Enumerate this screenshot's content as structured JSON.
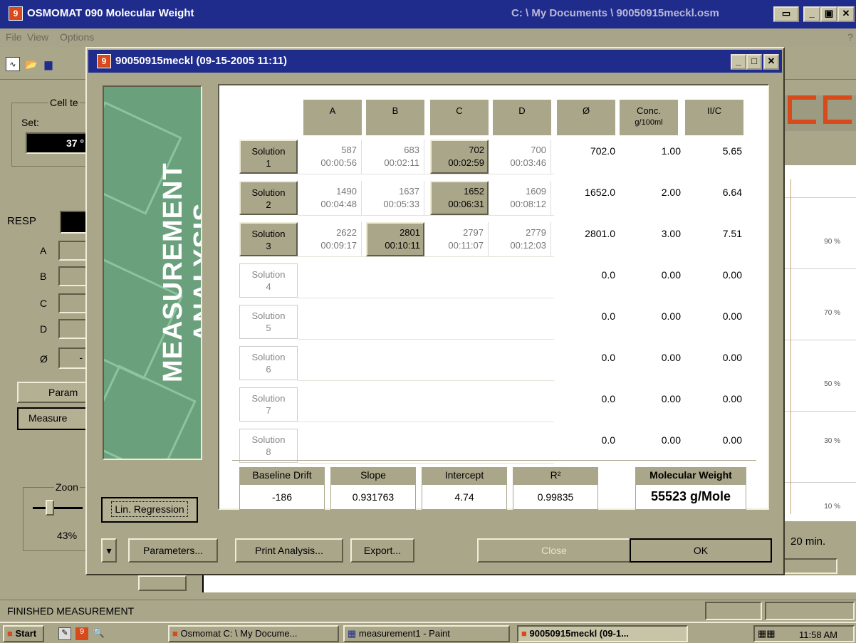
{
  "app": {
    "title": "OSMOMAT 090 Molecular Weight",
    "path": "C: \\ My Documents \\ 90050915meckl.osm",
    "menu": [
      "File",
      "View",
      "Options"
    ],
    "help": "?"
  },
  "left_panel": {
    "cell_temp_label": "Cell te",
    "set_label": "Set:",
    "set_value": "37 °",
    "resp_label": "RESP",
    "rows": [
      "A",
      "B",
      "C",
      "D",
      "Ø"
    ],
    "phi_value": "-",
    "param_button": "Param",
    "measure_button": "Measure",
    "zoom_label": "Zoon",
    "zoom_value": "43%",
    "zoom_level_percent": 43
  },
  "graph": {
    "percent_labels": [
      "90 %",
      "70 %",
      "50 %",
      "30 %",
      "10 %"
    ],
    "time_label": "20 min."
  },
  "status_bar": "FINISHED MEASUREMENT",
  "dialog": {
    "title": "90050915meckl (09-15-2005 11:11)",
    "sidebar_text": "MEASUREMENT ANALYSIS",
    "columns": [
      "A",
      "B",
      "C",
      "D",
      "Ø",
      "Conc.",
      "ΙΙ/C"
    ],
    "conc_unit": "g/100ml",
    "solutions": [
      {
        "label": "Solution",
        "num": "1",
        "active": true,
        "cells": [
          {
            "v": "587",
            "t": "00:00:56",
            "sel": false
          },
          {
            "v": "683",
            "t": "00:02:11",
            "sel": false
          },
          {
            "v": "702",
            "t": "00:02:59",
            "sel": true
          },
          {
            "v": "700",
            "t": "00:03:46",
            "sel": false
          }
        ],
        "phi": "702.0",
        "conc": "1.00",
        "pic": "5.65"
      },
      {
        "label": "Solution",
        "num": "2",
        "active": true,
        "cells": [
          {
            "v": "1490",
            "t": "00:04:48",
            "sel": false
          },
          {
            "v": "1637",
            "t": "00:05:33",
            "sel": false
          },
          {
            "v": "1652",
            "t": "00:06:31",
            "sel": true
          },
          {
            "v": "1609",
            "t": "00:08:12",
            "sel": false
          }
        ],
        "phi": "1652.0",
        "conc": "2.00",
        "pic": "6.64"
      },
      {
        "label": "Solution",
        "num": "3",
        "active": true,
        "cells": [
          {
            "v": "2622",
            "t": "00:09:17",
            "sel": false
          },
          {
            "v": "2801",
            "t": "00:10:11",
            "sel": true
          },
          {
            "v": "2797",
            "t": "00:11:07",
            "sel": false
          },
          {
            "v": "2779",
            "t": "00:12:03",
            "sel": false
          }
        ],
        "phi": "2801.0",
        "conc": "3.00",
        "pic": "7.51"
      },
      {
        "label": "Solution",
        "num": "4",
        "active": false,
        "cells": [],
        "phi": "0.0",
        "conc": "0.00",
        "pic": "0.00"
      },
      {
        "label": "Solution",
        "num": "5",
        "active": false,
        "cells": [],
        "phi": "0.0",
        "conc": "0.00",
        "pic": "0.00"
      },
      {
        "label": "Solution",
        "num": "6",
        "active": false,
        "cells": [],
        "phi": "0.0",
        "conc": "0.00",
        "pic": "0.00"
      },
      {
        "label": "Solution",
        "num": "7",
        "active": false,
        "cells": [],
        "phi": "0.0",
        "conc": "0.00",
        "pic": "0.00"
      },
      {
        "label": "Solution",
        "num": "8",
        "active": false,
        "cells": [],
        "phi": "0.0",
        "conc": "0.00",
        "pic": "0.00"
      }
    ],
    "stats": {
      "baseline_drift_label": "Baseline Drift",
      "baseline_drift": "-186",
      "slope_label": "Slope",
      "slope": "0.931763",
      "intercept_label": "Intercept",
      "intercept": "4.74",
      "r2_label": "R²",
      "r2": "0.99835",
      "mw_label": "Molecular Weight",
      "mw": "55523 g/Mole"
    },
    "buttons": {
      "lin_regression": "Lin. Regression",
      "parameters": "Parameters...",
      "print": "Print Analysis...",
      "export": "Export...",
      "close": "Close",
      "ok": "OK"
    }
  },
  "taskbar": {
    "start": "Start",
    "tasks": [
      "Osmomat C: \\ My Docume...",
      "measurement1 - Paint",
      "90050915meckl (09-1..."
    ],
    "clock": "11:58 AM"
  }
}
